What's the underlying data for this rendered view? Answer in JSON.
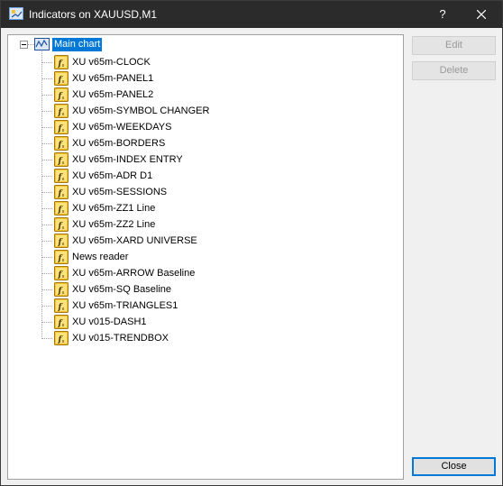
{
  "window": {
    "title": "Indicators on XAUUSD,M1",
    "help_label": "?"
  },
  "tree": {
    "root_label": "Main chart",
    "items": [
      {
        "label": "XU v65m-CLOCK"
      },
      {
        "label": "XU v65m-PANEL1"
      },
      {
        "label": "XU v65m-PANEL2"
      },
      {
        "label": "XU v65m-SYMBOL CHANGER"
      },
      {
        "label": "XU v65m-WEEKDAYS"
      },
      {
        "label": "XU v65m-BORDERS"
      },
      {
        "label": "XU v65m-INDEX ENTRY"
      },
      {
        "label": "XU v65m-ADR D1"
      },
      {
        "label": "XU v65m-SESSIONS"
      },
      {
        "label": "XU v65m-ZZ1 Line"
      },
      {
        "label": "XU v65m-ZZ2 Line"
      },
      {
        "label": "XU v65m-XARD UNIVERSE"
      },
      {
        "label": "News reader"
      },
      {
        "label": "XU v65m-ARROW Baseline"
      },
      {
        "label": "XU v65m-SQ Baseline"
      },
      {
        "label": "XU v65m-TRIANGLES1"
      },
      {
        "label": "XU v015-DASH1"
      },
      {
        "label": "XU v015-TRENDBOX"
      }
    ]
  },
  "buttons": {
    "edit": "Edit",
    "delete": "Delete",
    "close": "Close"
  },
  "colors": {
    "titlebar": "#2b2b2b",
    "selection": "#0078d7",
    "indicator_icon": "#f2c230"
  },
  "icons": {
    "app": "app-icon",
    "root": "chart-icon",
    "item": "indicator-icon",
    "close": "close-icon"
  }
}
